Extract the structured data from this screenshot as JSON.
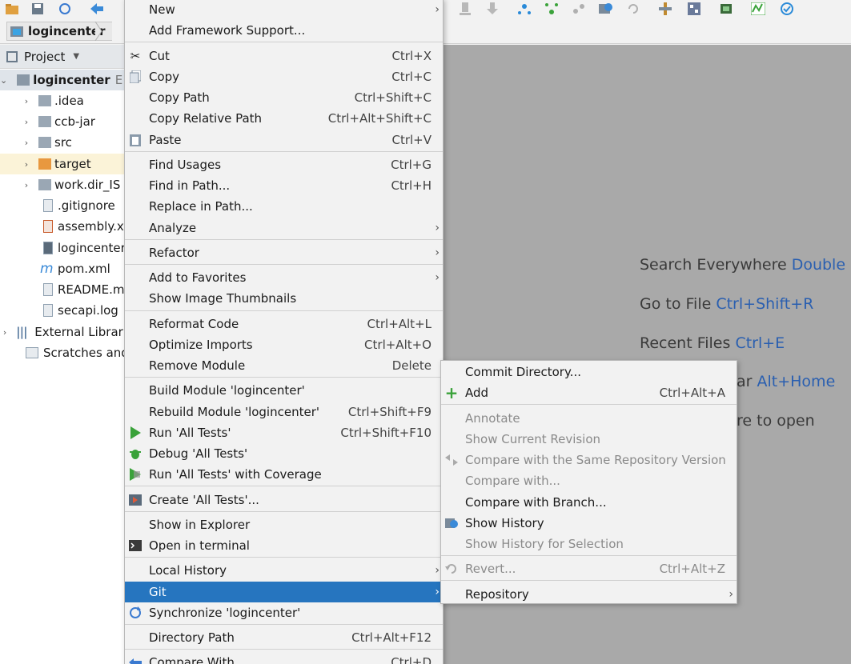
{
  "navbar": {
    "breadcrumb": "logincenter"
  },
  "project": {
    "header": "Project",
    "tree": [
      {
        "label": "logincenter",
        "suffix": "E:",
        "type": "module"
      },
      {
        "label": ".idea",
        "type": "folder"
      },
      {
        "label": "ccb-jar",
        "type": "folder"
      },
      {
        "label": "src",
        "type": "folder"
      },
      {
        "label": "target",
        "type": "folder-excluded"
      },
      {
        "label": "work.dir_IS",
        "type": "folder"
      },
      {
        "label": ".gitignore",
        "type": "file"
      },
      {
        "label": "assembly.xi",
        "type": "file"
      },
      {
        "label": "logincenter",
        "type": "file"
      },
      {
        "label": "pom.xml",
        "type": "maven"
      },
      {
        "label": "README.m",
        "type": "file"
      },
      {
        "label": "secapi.log",
        "type": "file"
      },
      {
        "label": "External Librari",
        "type": "libs"
      },
      {
        "label": "Scratches and",
        "type": "scratch"
      }
    ]
  },
  "editor": {
    "hints": [
      {
        "text": "Search Everywhere ",
        "key": "Double S"
      },
      {
        "text": "Go to File ",
        "key": "Ctrl+Shift+R"
      },
      {
        "text": "Recent Files ",
        "key": "Ctrl+E"
      },
      {
        "text": "ar ",
        "key": "Alt+Home"
      },
      {
        "text": "re to open",
        "key": ""
      }
    ]
  },
  "context_menu": {
    "items": [
      {
        "label": "New",
        "shortcut": ""
      },
      {
        "label": "Add Framework Support...",
        "shortcut": ""
      },
      {
        "label": "Cut",
        "shortcut": "Ctrl+X"
      },
      {
        "label": "Copy",
        "shortcut": "Ctrl+C"
      },
      {
        "label": "Copy Path",
        "shortcut": "Ctrl+Shift+C"
      },
      {
        "label": "Copy Relative Path",
        "shortcut": "Ctrl+Alt+Shift+C"
      },
      {
        "label": "Paste",
        "shortcut": "Ctrl+V"
      },
      {
        "label": "Find Usages",
        "shortcut": "Ctrl+G"
      },
      {
        "label": "Find in Path...",
        "shortcut": "Ctrl+H"
      },
      {
        "label": "Replace in Path...",
        "shortcut": ""
      },
      {
        "label": "Analyze",
        "shortcut": ""
      },
      {
        "label": "Refactor",
        "shortcut": ""
      },
      {
        "label": "Add to Favorites",
        "shortcut": ""
      },
      {
        "label": "Show Image Thumbnails",
        "shortcut": ""
      },
      {
        "label": "Reformat Code",
        "shortcut": "Ctrl+Alt+L"
      },
      {
        "label": "Optimize Imports",
        "shortcut": "Ctrl+Alt+O"
      },
      {
        "label": "Remove Module",
        "shortcut": "Delete"
      },
      {
        "label": "Build Module 'logincenter'",
        "shortcut": ""
      },
      {
        "label": "Rebuild Module 'logincenter'",
        "shortcut": "Ctrl+Shift+F9"
      },
      {
        "label": "Run 'All Tests'",
        "shortcut": "Ctrl+Shift+F10"
      },
      {
        "label": "Debug 'All Tests'",
        "shortcut": ""
      },
      {
        "label": "Run 'All Tests' with Coverage",
        "shortcut": ""
      },
      {
        "label": "Create 'All Tests'...",
        "shortcut": ""
      },
      {
        "label": "Show in Explorer",
        "shortcut": ""
      },
      {
        "label": "Open in terminal",
        "shortcut": ""
      },
      {
        "label": "Local History",
        "shortcut": ""
      },
      {
        "label": "Git",
        "shortcut": ""
      },
      {
        "label": "Synchronize 'logincenter'",
        "shortcut": ""
      },
      {
        "label": "Directory Path",
        "shortcut": "Ctrl+Alt+F12"
      },
      {
        "label": "Compare With...",
        "shortcut": "Ctrl+D"
      }
    ]
  },
  "git_submenu": {
    "items": [
      {
        "label": "Commit Directory...",
        "shortcut": ""
      },
      {
        "label": "Add",
        "shortcut": "Ctrl+Alt+A"
      },
      {
        "label": "Annotate",
        "shortcut": ""
      },
      {
        "label": "Show Current Revision",
        "shortcut": ""
      },
      {
        "label": "Compare with the Same Repository Version",
        "shortcut": ""
      },
      {
        "label": "Compare with...",
        "shortcut": ""
      },
      {
        "label": "Compare with Branch...",
        "shortcut": ""
      },
      {
        "label": "Show History",
        "shortcut": ""
      },
      {
        "label": "Show History for Selection",
        "shortcut": ""
      },
      {
        "label": "Revert...",
        "shortcut": "Ctrl+Alt+Z"
      },
      {
        "label": "Repository",
        "shortcut": ""
      }
    ]
  },
  "colors": {
    "highlight": "#2675bf",
    "editor_bg": "#a9a9a9",
    "key": "#2a5fb0",
    "add_green": "#3aa23a"
  }
}
